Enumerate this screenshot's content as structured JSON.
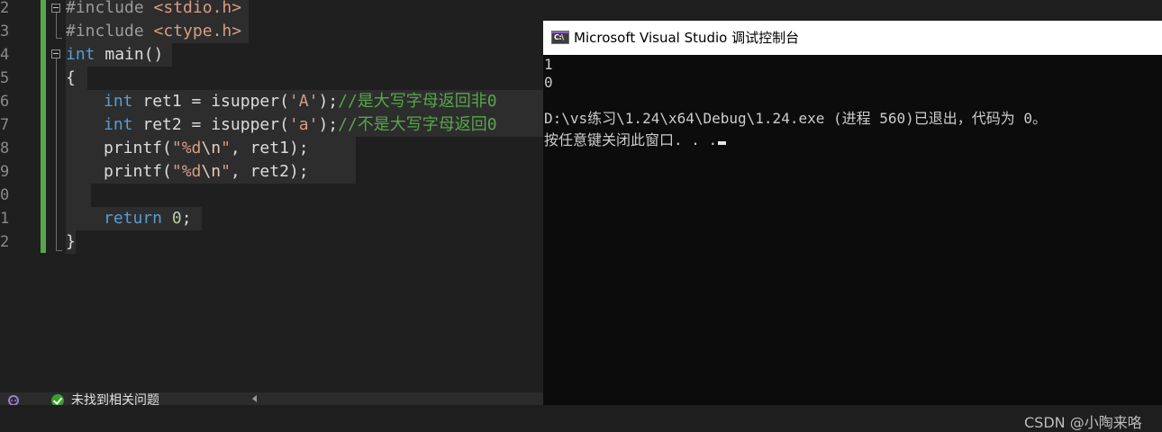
{
  "editor": {
    "line_numbers": [
      "2",
      "3",
      "4",
      "5",
      "6",
      "7",
      "8",
      "9",
      "0",
      "1",
      "2"
    ],
    "code": {
      "l1": {
        "directive": "#include",
        "header": "<stdio.h>"
      },
      "l2": {
        "directive": "#include",
        "header": "<ctype.h>"
      },
      "l3": {
        "type": "int",
        "rest": " main()"
      },
      "l4": {
        "brace_open": "{"
      },
      "l5": {
        "type": "int",
        "decl": " ret1 = ",
        "fn": "isupper",
        "open": "(",
        "arg": "'A'",
        "close": ");",
        "comment": "//是大写字母返回非0"
      },
      "l6": {
        "type": "int",
        "decl": " ret2 = ",
        "fn": "isupper",
        "open": "(",
        "arg": "'a'",
        "close": ");",
        "comment": "//不是大写字母返回0"
      },
      "l7": {
        "fn": "printf",
        "open": "(",
        "str_a": "\"%d",
        "esc": "\\n",
        "str_b": "\"",
        "rest": ", ret1);"
      },
      "l8": {
        "fn": "printf",
        "open": "(",
        "str_a": "\"%d",
        "esc": "\\n",
        "str_b": "\"",
        "rest": ", ret2);"
      },
      "l10": {
        "keyword": "return",
        "space": " ",
        "value": "0",
        "end": ";"
      },
      "l11": {
        "brace_close": "}"
      }
    }
  },
  "statusbar": {
    "issues_text": "未找到相关问题"
  },
  "console": {
    "title": "Microsoft Visual Studio 调试控制台",
    "icon_label": "C:\\",
    "output": [
      "1",
      "0",
      "",
      "D:\\vs练习\\1.24\\x64\\Debug\\1.24.exe (进程 560)已退出，代码为 0。",
      "按任意键关闭此窗口. . ."
    ]
  },
  "watermark": "CSDN @小陶来咯",
  "colors": {
    "editor_bg": "#1f1f1f",
    "keyword": "#569cd6",
    "string": "#d69d85",
    "comment": "#57a64a",
    "number": "#b5cea8",
    "function": "#dcdcaa",
    "console_bg": "#0c0c0c"
  }
}
